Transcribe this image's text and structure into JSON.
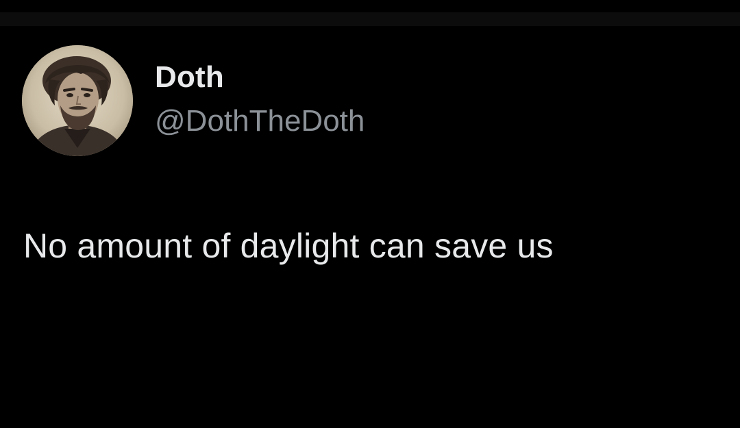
{
  "tweet": {
    "author": {
      "display_name": "Doth",
      "handle": "@DothTheDoth",
      "avatar_icon": "portrait-avatar"
    },
    "text": "No amount of daylight can save us"
  },
  "colors": {
    "background": "#000000",
    "text_primary": "#e7e9ea",
    "text_secondary": "#8b9197"
  }
}
